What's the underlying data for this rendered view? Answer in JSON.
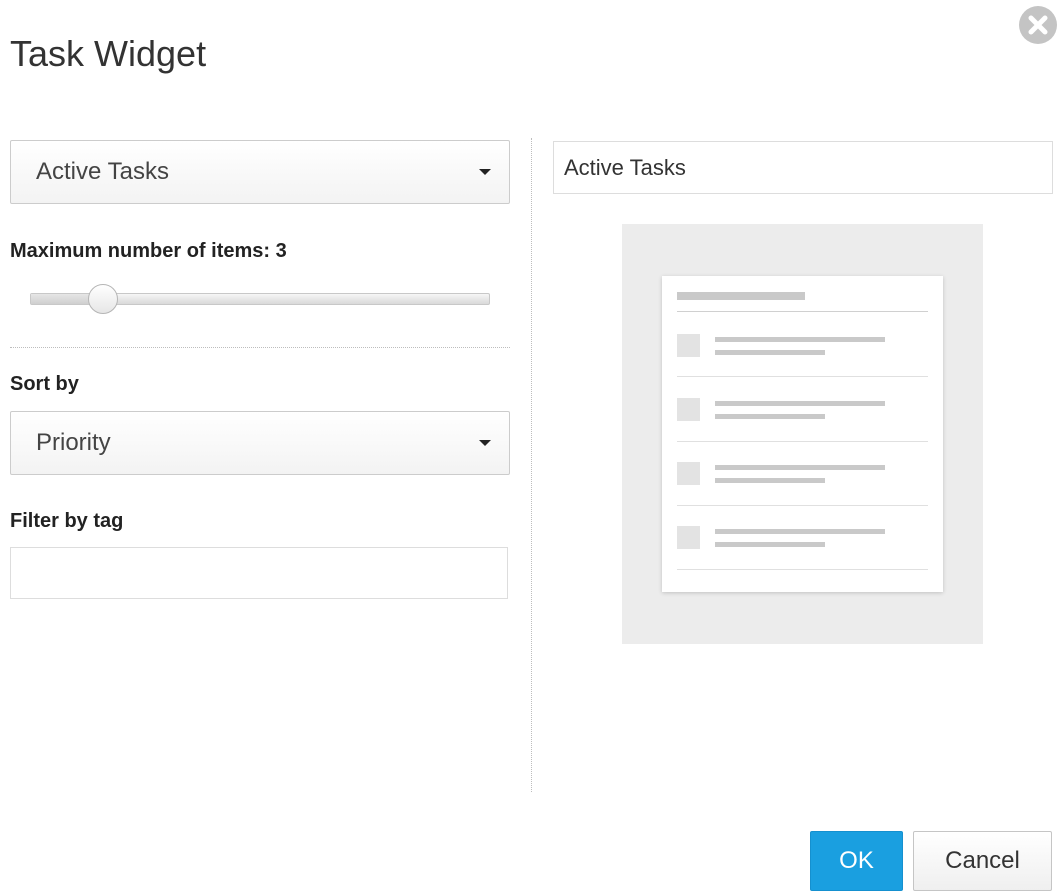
{
  "dialog": {
    "title": "Task Widget"
  },
  "settings": {
    "list_select": {
      "value": "Active Tasks"
    },
    "max_items": {
      "label": "Maximum number of items: 3",
      "value": 3,
      "min": 1,
      "max": 25
    },
    "sort": {
      "label": "Sort by",
      "value": "Priority"
    },
    "filter": {
      "label": "Filter by tag",
      "value": "",
      "placeholder": ""
    }
  },
  "preview": {
    "title_value": "Active Tasks"
  },
  "footer": {
    "ok_label": "OK",
    "cancel_label": "Cancel"
  },
  "colors": {
    "accent": "#1a9fe0",
    "close_icon": "#c4c4c4"
  },
  "icons": {
    "close": "close-circle-icon",
    "dropdown": "caret-down-icon"
  }
}
